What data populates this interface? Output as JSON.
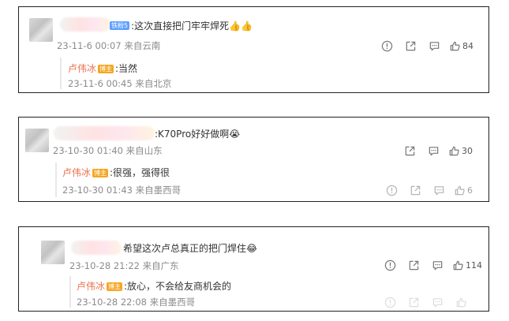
{
  "comments": [
    {
      "text": ":这次直接把门牢牢焊死",
      "emoji": "👍👍",
      "fan_badge": "铁粉5",
      "time": "23-11-6 00:07",
      "location": "来自云南",
      "likes": "84",
      "reply": {
        "author": "卢伟冰",
        "badge": "博主",
        "text": ":当然",
        "time": "23-11-6 00:45",
        "location": "来自北京"
      }
    },
    {
      "text": ":K70Pro好好做啊",
      "emoji": "😭",
      "time": "23-10-30 01:40",
      "location": "来自山东",
      "likes": "30",
      "reply": {
        "author": "卢伟冰",
        "badge": "博主",
        "text": ":很强，强得很",
        "time": "23-10-30 01:43",
        "location": "来自墨西哥",
        "likes": "6"
      }
    },
    {
      "text": "希望这次卢总真正的把门焊住",
      "emoji": "😂",
      "time": "23-10-28 21:22",
      "location": "来自广东",
      "likes": "114",
      "reply": {
        "author": "卢伟冰",
        "badge": "博主",
        "text": ":放心，不会给友商机会的",
        "time": "23-10-28 22:08",
        "location": "来自墨西哥"
      }
    }
  ],
  "icons": [
    "report-icon",
    "share-icon",
    "comment-icon",
    "like-icon"
  ]
}
